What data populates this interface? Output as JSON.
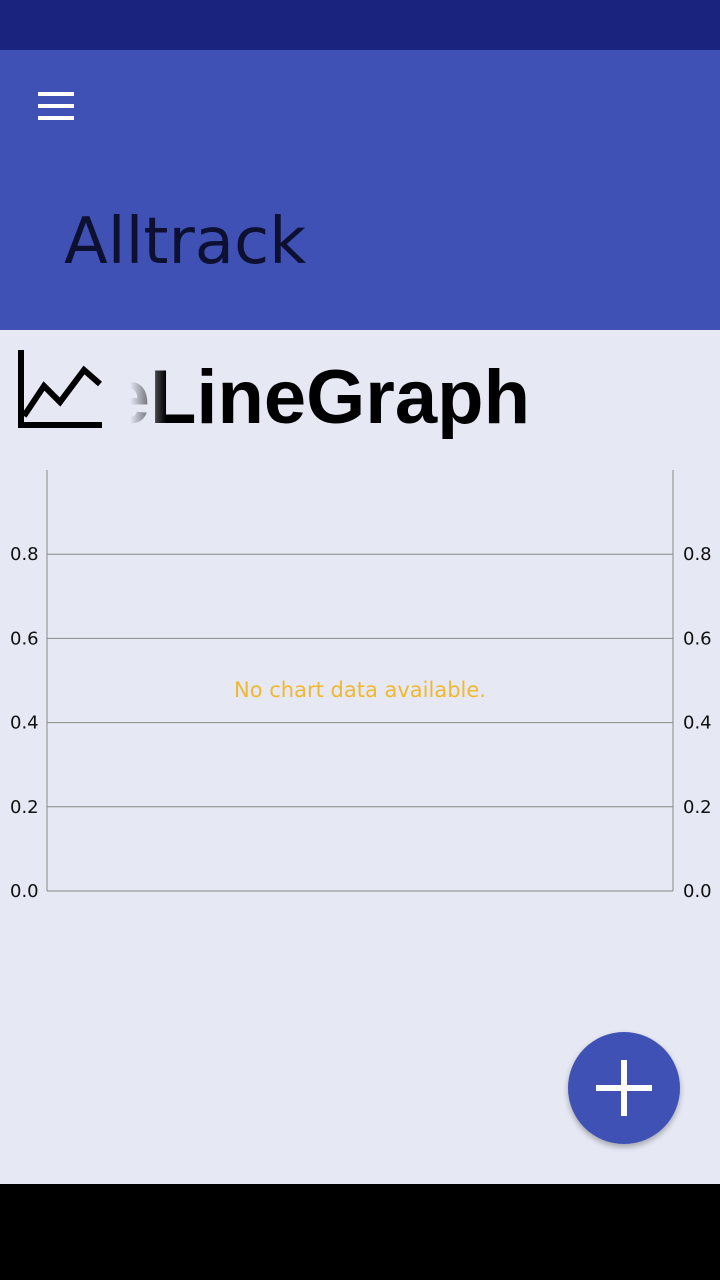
{
  "app_bar": {
    "title": "Alltrack",
    "menu_icon": "hamburger-menu-icon"
  },
  "graph": {
    "icon": "line-chart-icon",
    "name_visible": "eLineGraph"
  },
  "chart_data": {
    "type": "line",
    "title": "",
    "xlabel": "",
    "ylabel": "",
    "series": [],
    "ylim": [
      0.0,
      1.0
    ],
    "y_ticks": [
      "0.0",
      "0.2",
      "0.4",
      "0.6",
      "0.8"
    ],
    "right_axis_ticks": [
      "0.0",
      "0.2",
      "0.4",
      "0.6",
      "0.8"
    ],
    "grid": true,
    "empty_message": "No chart data available.",
    "empty_message_color": "#f0b830"
  },
  "fab": {
    "icon": "plus-icon"
  },
  "colors": {
    "primary": "#3f51b5",
    "primary_dark": "#1a237e",
    "background": "#e6e8f4"
  }
}
